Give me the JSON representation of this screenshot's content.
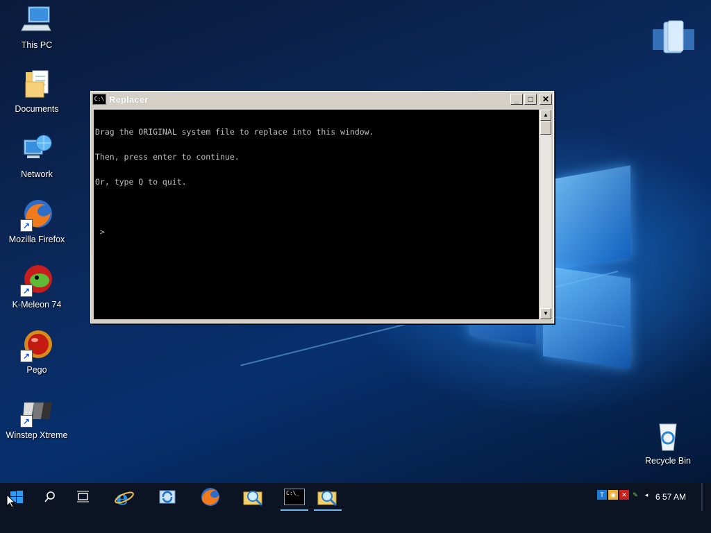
{
  "desktop": {
    "icons": [
      {
        "label": "This PC",
        "icon": "computer-icon"
      },
      {
        "label": "Documents",
        "icon": "folder-documents-icon"
      },
      {
        "label": "Network",
        "icon": "network-icon"
      },
      {
        "label": "Mozilla Firefox",
        "icon": "firefox-icon"
      },
      {
        "label": "K-Meleon 74",
        "icon": "kmeleon-icon"
      },
      {
        "label": "Pego",
        "icon": "pego-icon"
      },
      {
        "label": "Winstep Xtreme",
        "icon": "winstep-icon"
      },
      {
        "label": "Recycle Bin",
        "icon": "recycle-bin-icon"
      }
    ]
  },
  "window": {
    "title": "Replacer",
    "app_icon_text": "C:\\",
    "minimize": "_",
    "maximize": "□",
    "close": "✕",
    "console_lines": [
      "Drag the ORIGINAL system file to replace into this window.",
      "Then, press enter to continue.",
      "Or, type Q to quit.",
      "",
      " >"
    ]
  },
  "taskbar": {
    "clock": "6 57 AM",
    "cmd_icon_text": "C:\\_"
  },
  "colors": {
    "taskbar": "#0c1424",
    "console_bg": "#000000",
    "console_fg": "#c0c0c0",
    "window_frame": "#d4d0c8"
  }
}
